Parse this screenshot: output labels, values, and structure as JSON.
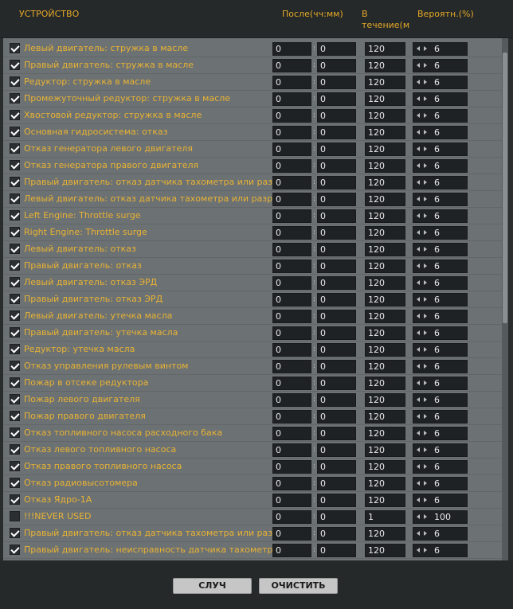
{
  "header": {
    "device": "УСТРОЙСТВО",
    "after": "После(чч:мм)",
    "during_line1": "В",
    "during_line2": "течение(м",
    "probability": "Вероятн.(%)"
  },
  "rows": [
    {
      "name": "Левый двигатель: стружка в масле",
      "checked": true,
      "hh": "0",
      "mm": "0",
      "dur": "120",
      "prob": "6"
    },
    {
      "name": "Правый двигатель: стружка в масле",
      "checked": true,
      "hh": "0",
      "mm": "0",
      "dur": "120",
      "prob": "6"
    },
    {
      "name": "Редуктор: стружка в масле",
      "checked": true,
      "hh": "0",
      "mm": "0",
      "dur": "120",
      "prob": "6"
    },
    {
      "name": "Промежуточный редуктор: стружка в масле",
      "checked": true,
      "hh": "0",
      "mm": "0",
      "dur": "120",
      "prob": "6"
    },
    {
      "name": "Хвостовой редуктор: стружка в масле",
      "checked": true,
      "hh": "0",
      "mm": "0",
      "dur": "120",
      "prob": "6"
    },
    {
      "name": "Основная гидросистема: отказ",
      "checked": true,
      "hh": "0",
      "mm": "0",
      "dur": "120",
      "prob": "6"
    },
    {
      "name": "Отказ генератора левого двигателя",
      "checked": true,
      "hh": "0",
      "mm": "0",
      "dur": "120",
      "prob": "6"
    },
    {
      "name": "Отказ генератора правого двигателя",
      "checked": true,
      "hh": "0",
      "mm": "0",
      "dur": "120",
      "prob": "6"
    },
    {
      "name": "Правый двигатель: отказ датчика тахометра или разр",
      "checked": true,
      "hh": "0",
      "mm": "0",
      "dur": "120",
      "prob": "6"
    },
    {
      "name": "Левый двигатель: отказ датчика тахометра или разрь",
      "checked": true,
      "hh": "0",
      "mm": "0",
      "dur": "120",
      "prob": "6"
    },
    {
      "name": "Left Engine: Throttle surge",
      "checked": true,
      "hh": "0",
      "mm": "0",
      "dur": "120",
      "prob": "6"
    },
    {
      "name": "Right Engine: Throttle surge",
      "checked": true,
      "hh": "0",
      "mm": "0",
      "dur": "120",
      "prob": "6"
    },
    {
      "name": "Левый двигатель: отказ",
      "checked": true,
      "hh": "0",
      "mm": "0",
      "dur": "120",
      "prob": "6"
    },
    {
      "name": "Правый двигатель: отказ",
      "checked": true,
      "hh": "0",
      "mm": "0",
      "dur": "120",
      "prob": "6"
    },
    {
      "name": "Левый двигатель: отказ ЭРД",
      "checked": true,
      "hh": "0",
      "mm": "0",
      "dur": "120",
      "prob": "6"
    },
    {
      "name": "Правый двигатель: отказ ЭРД",
      "checked": true,
      "hh": "0",
      "mm": "0",
      "dur": "120",
      "prob": "6"
    },
    {
      "name": "Левый двигатель: утечка масла",
      "checked": true,
      "hh": "0",
      "mm": "0",
      "dur": "120",
      "prob": "6"
    },
    {
      "name": "Правый двигатель: утечка масла",
      "checked": true,
      "hh": "0",
      "mm": "0",
      "dur": "120",
      "prob": "6"
    },
    {
      "name": "Редуктор: утечка масла",
      "checked": true,
      "hh": "0",
      "mm": "0",
      "dur": "120",
      "prob": "6"
    },
    {
      "name": "Отказ управления рулевым винтом",
      "checked": true,
      "hh": "0",
      "mm": "0",
      "dur": "120",
      "prob": "6"
    },
    {
      "name": "Пожар в отсеке редуктора",
      "checked": true,
      "hh": "0",
      "mm": "0",
      "dur": "120",
      "prob": "6"
    },
    {
      "name": "Пожар левого двигателя",
      "checked": true,
      "hh": "0",
      "mm": "0",
      "dur": "120",
      "prob": "6"
    },
    {
      "name": "Пожар правого двигателя",
      "checked": true,
      "hh": "0",
      "mm": "0",
      "dur": "120",
      "prob": "6"
    },
    {
      "name": "Отказ топливного насоса расходного бака",
      "checked": true,
      "hh": "0",
      "mm": "0",
      "dur": "120",
      "prob": "6"
    },
    {
      "name": "Отказ левого топливного насоса",
      "checked": true,
      "hh": "0",
      "mm": "0",
      "dur": "120",
      "prob": "6"
    },
    {
      "name": "Отказ правого топливного насоса",
      "checked": true,
      "hh": "0",
      "mm": "0",
      "dur": "120",
      "prob": "6"
    },
    {
      "name": "Отказ радиовысотомера",
      "checked": true,
      "hh": "0",
      "mm": "0",
      "dur": "120",
      "prob": "6"
    },
    {
      "name": "Отказ Ядро-1А",
      "checked": true,
      "hh": "0",
      "mm": "0",
      "dur": "120",
      "prob": "6"
    },
    {
      "name": "!!!NEVER USED",
      "checked": false,
      "hh": "0",
      "mm": "0",
      "dur": "1",
      "prob": "100"
    },
    {
      "name": "Правый двигатель: отказ датчика тахометра или разр",
      "checked": true,
      "hh": "0",
      "mm": "0",
      "dur": "120",
      "prob": "6"
    },
    {
      "name": "Правый двигатель: неисправность датчика тахометра",
      "checked": true,
      "hh": "0",
      "mm": "0",
      "dur": "120",
      "prob": "6"
    }
  ],
  "footer": {
    "random_label": "СЛУЧ",
    "clear_label": "ОЧИСТИТЬ"
  }
}
